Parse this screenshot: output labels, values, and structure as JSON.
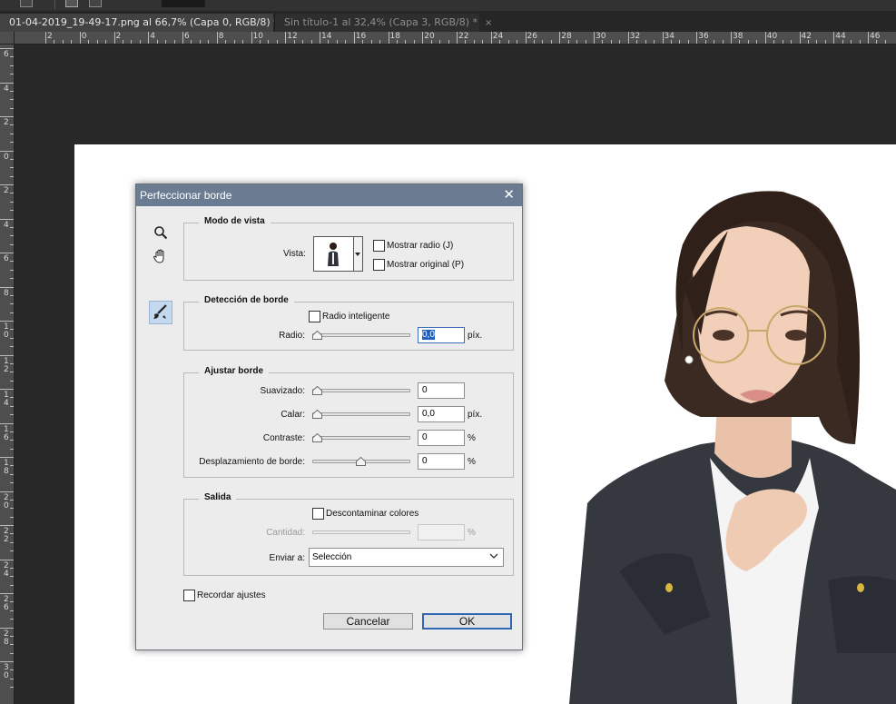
{
  "tabs": [
    {
      "label": "01-04-2019_19-49-17.png al 66,7% (Capa 0, RGB/8) *",
      "close": "×"
    },
    {
      "label": "Sin título-1 al 32,4% (Capa 3, RGB/8) *",
      "close": "×"
    }
  ],
  "ruler": {
    "h_labels": [
      "2",
      "0",
      "2",
      "4",
      "6",
      "8",
      "10",
      "12",
      "14",
      "16",
      "18",
      "20",
      "22",
      "24",
      "26",
      "28",
      "30",
      "32",
      "34",
      "36",
      "38",
      "40",
      "42",
      "44",
      "46"
    ],
    "v_labels": [
      "6",
      "4",
      "2",
      "0",
      "2",
      "4",
      "6",
      "8",
      "10",
      "12",
      "14",
      "16",
      "18",
      "20",
      "22",
      "24",
      "26",
      "28",
      "30"
    ]
  },
  "dialog": {
    "title": "Perfeccionar borde",
    "close": "✕",
    "view_mode": {
      "title": "Modo de vista",
      "view_label": "Vista:",
      "show_radius_label": "Mostrar radio (J)",
      "show_radius_checked": false,
      "show_original_label": "Mostrar original (P)",
      "show_original_checked": false
    },
    "edge_detection": {
      "title": "Detección de borde",
      "smart_radius_label": "Radio inteligente",
      "smart_radius_checked": false,
      "radius_label": "Radio:",
      "radius_value": "0,0",
      "radius_unit": "píx.",
      "radius_level": 0
    },
    "adjust_edge": {
      "title": "Ajustar borde",
      "smooth_label": "Suavizado:",
      "smooth_value": "0",
      "smooth_level": 0,
      "feather_label": "Calar:",
      "feather_value": "0,0",
      "feather_unit": "píx.",
      "feather_level": 0,
      "contrast_label": "Contraste:",
      "contrast_value": "0",
      "contrast_unit": "%",
      "contrast_level": 0,
      "shift_label": "Desplazamiento de borde:",
      "shift_value": "0",
      "shift_unit": "%",
      "shift_level": 0.5
    },
    "output": {
      "title": "Salida",
      "decontaminate_label": "Descontaminar colores",
      "decontaminate_checked": false,
      "amount_label": "Cantidad:",
      "amount_value": "",
      "amount_unit": "%",
      "output_to_label": "Enviar a:",
      "output_to_value": "Selección"
    },
    "remember_label": "Recordar ajustes",
    "remember_checked": false,
    "cancel_label": "Cancelar",
    "ok_label": "OK"
  },
  "colors": {
    "title_bar": "#6b7b91",
    "dialog_bg": "#ececec",
    "focus_blue": "#1f5fbf"
  }
}
